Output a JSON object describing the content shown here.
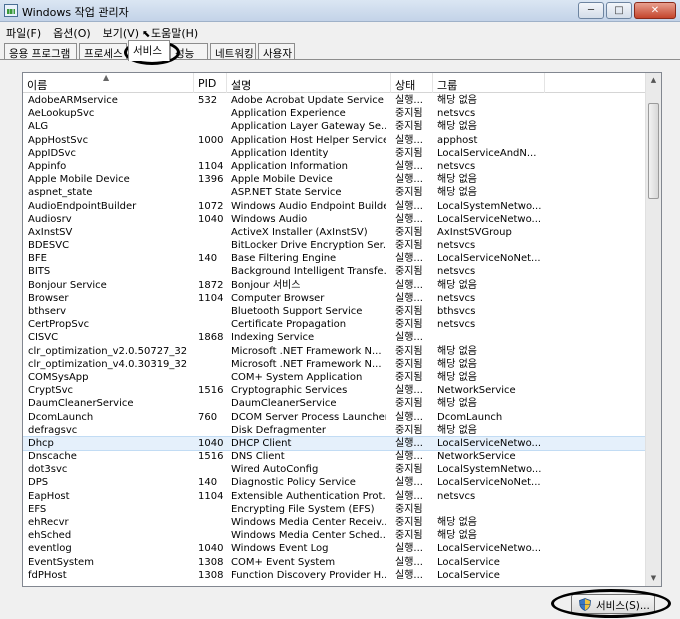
{
  "window": {
    "title": "Windows 작업 관리자",
    "controls": [
      "─",
      "□",
      "✕"
    ]
  },
  "menu": [
    "파일(F)",
    "옵션(O)",
    "보기(V)",
    "도움말(H)"
  ],
  "tabs": [
    "응용 프로그램",
    "프로세스",
    "서비스",
    "성능",
    "네트워킹",
    "사용자"
  ],
  "active_tab": "서비스",
  "columns": {
    "name": "이름",
    "pid": "PID",
    "description": "설명",
    "status": "상태",
    "group": "그룹"
  },
  "rows": [
    [
      "AdobeARMservice",
      "532",
      "Adobe Acrobat Update Service",
      "실행...",
      "해당 없음"
    ],
    [
      "AeLookupSvc",
      "",
      "Application Experience",
      "중지됨",
      "netsvcs"
    ],
    [
      "ALG",
      "",
      "Application Layer Gateway Se...",
      "중지됨",
      "해당 없음"
    ],
    [
      "AppHostSvc",
      "1000",
      "Application Host Helper Service",
      "실행...",
      "apphost"
    ],
    [
      "AppIDSvc",
      "",
      "Application Identity",
      "중지됨",
      "LocalServiceAndN..."
    ],
    [
      "Appinfo",
      "1104",
      "Application Information",
      "실행...",
      "netsvcs"
    ],
    [
      "Apple Mobile Device",
      "1396",
      "Apple Mobile Device",
      "실행...",
      "해당 없음"
    ],
    [
      "aspnet_state",
      "",
      "ASP.NET State Service",
      "중지됨",
      "해당 없음"
    ],
    [
      "AudioEndpointBuilder",
      "1072",
      "Windows Audio Endpoint Builder",
      "실행...",
      "LocalSystemNetwo..."
    ],
    [
      "Audiosrv",
      "1040",
      "Windows Audio",
      "실행...",
      "LocalServiceNetwo..."
    ],
    [
      "AxInstSV",
      "",
      "ActiveX Installer (AxInstSV)",
      "중지됨",
      "AxInstSVGroup"
    ],
    [
      "BDESVC",
      "",
      "BitLocker Drive Encryption Ser...",
      "중지됨",
      "netsvcs"
    ],
    [
      "BFE",
      "140",
      "Base Filtering Engine",
      "실행...",
      "LocalServiceNoNet..."
    ],
    [
      "BITS",
      "",
      "Background Intelligent Transfe...",
      "중지됨",
      "netsvcs"
    ],
    [
      "Bonjour Service",
      "1872",
      "Bonjour 서비스",
      "실행...",
      "해당 없음"
    ],
    [
      "Browser",
      "1104",
      "Computer Browser",
      "실행...",
      "netsvcs"
    ],
    [
      "bthserv",
      "",
      "Bluetooth Support Service",
      "중지됨",
      "bthsvcs"
    ],
    [
      "CertPropSvc",
      "",
      "Certificate Propagation",
      "중지됨",
      "netsvcs"
    ],
    [
      "CISVC",
      "1868",
      "Indexing Service",
      "실행...",
      ""
    ],
    [
      "clr_optimization_v2.0.50727_32",
      "",
      "Microsoft .NET Framework N...",
      "중지됨",
      "해당 없음"
    ],
    [
      "clr_optimization_v4.0.30319_32",
      "",
      "Microsoft .NET Framework N...",
      "중지됨",
      "해당 없음"
    ],
    [
      "COMSysApp",
      "",
      "COM+ System Application",
      "중지됨",
      "해당 없음"
    ],
    [
      "CryptSvc",
      "1516",
      "Cryptographic Services",
      "실행...",
      "NetworkService"
    ],
    [
      "DaumCleanerService",
      "",
      "DaumCleanerService",
      "중지됨",
      "해당 없음"
    ],
    [
      "DcomLaunch",
      "760",
      "DCOM Server Process Launcher",
      "실행...",
      "DcomLaunch"
    ],
    [
      "defragsvc",
      "",
      "Disk Defragmenter",
      "중지됨",
      "해당 없음"
    ],
    [
      "Dhcp",
      "1040",
      "DHCP Client",
      "실행...",
      "LocalServiceNetwo..."
    ],
    [
      "Dnscache",
      "1516",
      "DNS Client",
      "실행...",
      "NetworkService"
    ],
    [
      "dot3svc",
      "",
      "Wired AutoConfig",
      "중지됨",
      "LocalSystemNetwo..."
    ],
    [
      "DPS",
      "140",
      "Diagnostic Policy Service",
      "실행...",
      "LocalServiceNoNet..."
    ],
    [
      "EapHost",
      "1104",
      "Extensible Authentication Prot...",
      "실행...",
      "netsvcs"
    ],
    [
      "EFS",
      "",
      "Encrypting File System (EFS)",
      "중지됨",
      ""
    ],
    [
      "ehRecvr",
      "",
      "Windows Media Center Receiv...",
      "중지됨",
      "해당 없음"
    ],
    [
      "ehSched",
      "",
      "Windows Media Center Sched...",
      "중지됨",
      "해당 없음"
    ],
    [
      "eventlog",
      "1040",
      "Windows Event Log",
      "실행...",
      "LocalServiceNetwo..."
    ],
    [
      "EventSystem",
      "1308",
      "COM+ Event System",
      "실행...",
      "LocalService"
    ],
    [
      "fdPHost",
      "1308",
      "Function Discovery Provider H...",
      "실행...",
      "LocalService"
    ]
  ],
  "selected_row": "Dhcp",
  "services_button": "서비스(S)..."
}
